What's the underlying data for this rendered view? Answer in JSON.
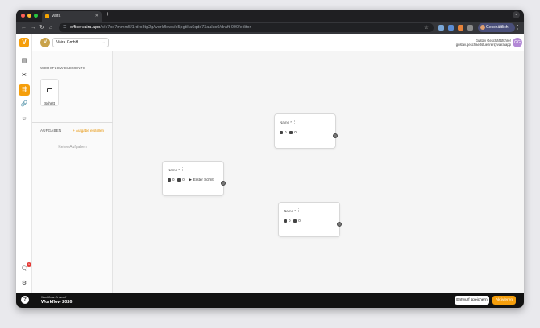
{
  "browser": {
    "tab_title": "Vaira",
    "new_tab": "+",
    "url_domain": "office.vaira.app",
    "url_path": "/o/c7be7mmm5f1rdro8tg2g/workflows/d5pgtika6qdc73aaluc0/draft-000/editor",
    "profile_label": "Geschäftlich"
  },
  "org": {
    "initial": "V",
    "selected": "Vaira GmbH"
  },
  "user": {
    "name": "Gustav Geschäftsführer",
    "email": "gustav.geschaeftsfuehrer@vaira.app",
    "initials": "GG"
  },
  "panel": {
    "elements_title": "WORKFLOW ELEMENTS",
    "element_label": "Schritt",
    "tasks_title": "AUFGABEN",
    "add_task": "+ Aufgabe erstellen",
    "empty_tasks": "Keine Aufgaben"
  },
  "nodes": [
    {
      "name": "Name *",
      "count_a": "0",
      "count_b": "0",
      "next": ""
    },
    {
      "name": "Name *",
      "count_a": "0",
      "count_b": "0",
      "next": "Erster Schritt"
    },
    {
      "name": "Name *",
      "count_a": "0",
      "count_b": "0",
      "next": ""
    }
  ],
  "rail": {
    "notification_count": "1"
  },
  "footer": {
    "help": "?",
    "subtitle": "Workflow-Entwurf",
    "workflow_name": "Workflow 2026",
    "save_label": "Entwurf speichern",
    "activate_label": "Aktivieren"
  },
  "colors": {
    "accent": "#f59e0b",
    "footer_bg": "#121212"
  }
}
